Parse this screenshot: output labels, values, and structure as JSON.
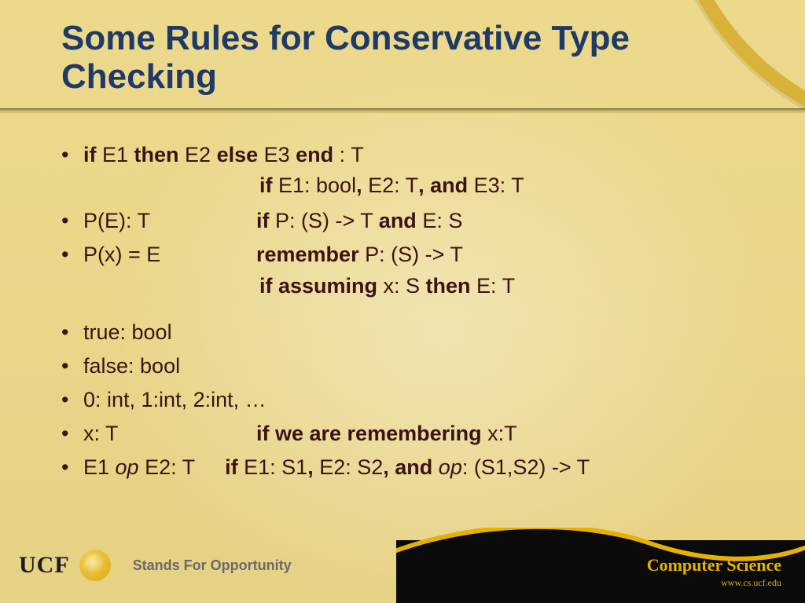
{
  "title": "Some Rules for Conservative Type Checking",
  "bullets": {
    "b1": {
      "kw_if": "if",
      "e1": " E1 ",
      "kw_then": "then",
      "e2": " E2 ",
      "kw_else": "else",
      "e3": " E3 ",
      "kw_end": "end",
      "tail": " : T"
    },
    "b1_sub": {
      "kw_if": "if",
      "mid": " E1: bool",
      "c1": ",",
      "e2": " E2: T",
      "c2": ", and",
      "e3": " E3: T"
    },
    "b2": {
      "lhs": "P(E): T",
      "kw_if": "if",
      "mid": " P: (S) -> T ",
      "kw_and": "and",
      "rhs": " E: S"
    },
    "b3": {
      "lhs": "P(x) = E",
      "kw_rem": "remember",
      "rhs": " P: (S) -> T"
    },
    "b3_sub": {
      "kw": "if assuming",
      "mid": " x: S ",
      "kw_then": "then",
      "rhs": " E: T"
    },
    "b4": "true: bool",
    "b5": "false: bool",
    "b6": "0: int, 1:int, 2:int, …",
    "b7": {
      "lhs": "x: T",
      "kw": "if we are remembering",
      "rhs": " x:T"
    },
    "b8": {
      "e1": "E1 ",
      "op1": "op",
      "e2": " E2: T",
      "sp": "    ",
      "kw_if": "if",
      "m1": " E1: S1",
      "c1": ",",
      "m2": " E2: S2",
      "c2": ", and",
      "sp2": " ",
      "op2": "op",
      "tail": ": (S1,S2) -> T"
    }
  },
  "footer": {
    "ucf": "UCF",
    "tagline": "Stands For Opportunity",
    "cs_title": "Computer Science",
    "cs_url": "www.cs.ucf.edu"
  }
}
